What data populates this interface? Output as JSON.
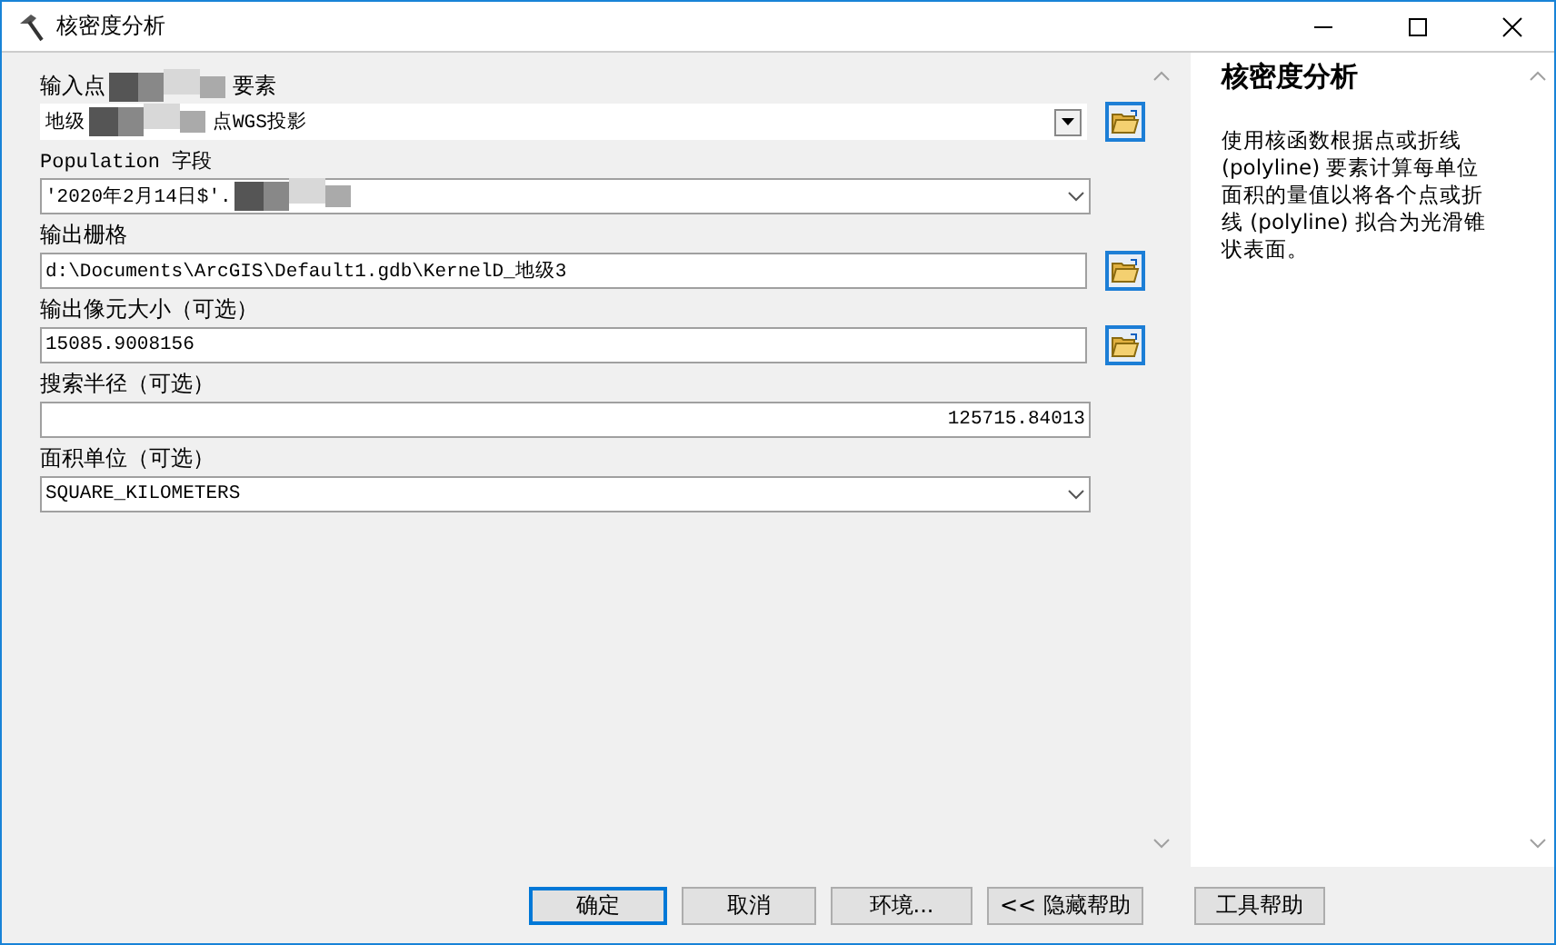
{
  "window": {
    "title": "核密度分析"
  },
  "params": [
    {
      "label_parts": [
        "输入点",
        "要素"
      ],
      "kind": "combo",
      "value_parts": [
        "地级",
        "点WGS投影"
      ],
      "redacted_tail": false,
      "browse": true
    },
    {
      "label_parts": [
        "Population 字段"
      ],
      "kind": "select",
      "value_parts": [
        "'2020年2月14日$'."
      ],
      "redacted_tail": true,
      "browse": false
    },
    {
      "label_parts": [
        "输出栅格"
      ],
      "kind": "text",
      "value_parts": [
        "d:\\Documents\\ArcGIS\\Default1.gdb\\KernelD_地级3"
      ],
      "redacted_tail": false,
      "browse": true
    },
    {
      "label_parts": [
        "输出像元大小（可选）"
      ],
      "kind": "text",
      "value_parts": [
        "15085.9008156"
      ],
      "redacted_tail": false,
      "browse": true
    },
    {
      "label_parts": [
        "搜索半径（可选）"
      ],
      "kind": "number",
      "value_parts": [
        "125715.84013"
      ],
      "redacted_tail": false,
      "browse": false
    },
    {
      "label_parts": [
        "面积单位（可选）"
      ],
      "kind": "select",
      "value_parts": [
        "SQUARE_KILOMETERS"
      ],
      "redacted_tail": false,
      "browse": false
    }
  ],
  "help": {
    "title": "核密度分析",
    "text": "使用核函数根据点或折线 (polyline) 要素计算每单位面积的量值以将各个点或折线 (polyline) 拟合为光滑锥状表面。"
  },
  "buttons": [
    {
      "label": "确定",
      "default": true
    },
    {
      "label": "取消",
      "default": false
    },
    {
      "label": "环境...",
      "default": false
    },
    {
      "label": "<< 隐藏帮助",
      "default": false
    },
    {
      "label": "工具帮助",
      "default": false
    }
  ]
}
